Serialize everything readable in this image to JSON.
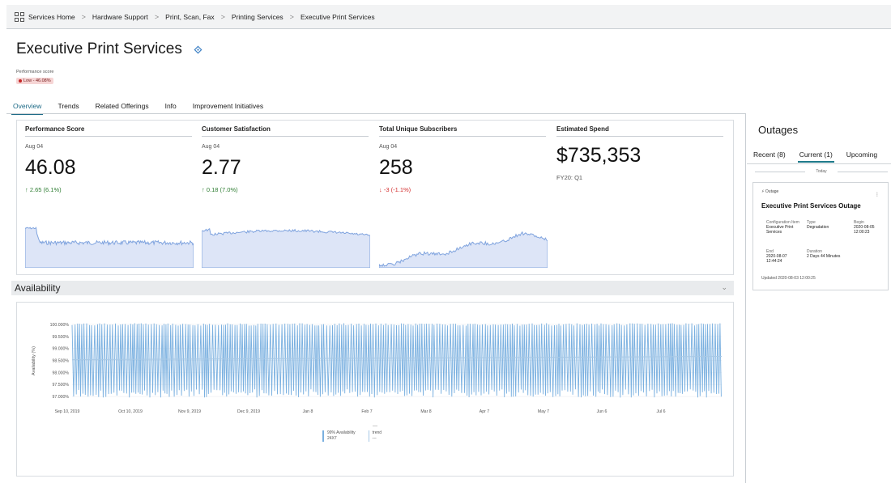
{
  "breadcrumb": [
    "Services Home",
    "Hardware Support",
    "Print, Scan, Fax",
    "Printing Services",
    "Executive Print Services"
  ],
  "page": {
    "title": "Executive Print Services",
    "performance_label": "Performance score",
    "performance_badge": "Low - 46.08%"
  },
  "tabs": [
    "Overview",
    "Trends",
    "Related Offerings",
    "Info",
    "Improvement Initiatives"
  ],
  "metrics": [
    {
      "label": "Performance Score",
      "date": "Aug 04",
      "value": "46.08",
      "delta": "↑ 2.65 (6.1%)",
      "trend": "up"
    },
    {
      "label": "Customer Satisfaction",
      "date": "Aug 04",
      "value": "2.77",
      "delta": "↑ 0.18 (7.0%)",
      "trend": "up"
    },
    {
      "label": "Total Unique Subscribers",
      "date": "Aug 04",
      "value": "258",
      "delta": "↓ -3 (-1.1%)",
      "trend": "down"
    },
    {
      "label": "Estimated Spend",
      "date": "",
      "value": "$735,353",
      "delta": "FY20: Q1",
      "trend": "neutral"
    }
  ],
  "availability": {
    "section_title": "Availability",
    "legend": [
      {
        "name": "99% Availability",
        "sub": "24X7"
      },
      {
        "name": "trend",
        "sub": "---"
      }
    ],
    "legend_dash": "—"
  },
  "chart_data": {
    "type": "line",
    "title": "",
    "ylabel": "Availability (%)",
    "ylim": [
      96.8,
      100.1
    ],
    "yticks": [
      "100.000%",
      "99.500%",
      "99.000%",
      "98.500%",
      "98.000%",
      "97.500%",
      "97.000%"
    ],
    "xticks": [
      "Sep 10, 2019",
      "Oct 10, 2019",
      "Nov 9, 2019",
      "Dec 9, 2019",
      "Jan 8",
      "Feb 7",
      "Mar 8",
      "Apr 7",
      "May 7",
      "Jun 6",
      "Jul 6"
    ],
    "series": [
      {
        "name": "99% Availability",
        "pattern": "oscillating between ~100.0% and ~97.0%",
        "color": "#7ab0e0"
      },
      {
        "name": "trend",
        "approx": 98.6,
        "color": "#a8c9e6"
      }
    ]
  },
  "outages": {
    "title": "Outages",
    "tabs": [
      "Recent (8)",
      "Current (1)",
      "Upcoming"
    ],
    "active_tab": 1,
    "day_label": "Today",
    "card": {
      "type_label": "Outage",
      "more": "⋮",
      "title": "Executive Print Services Outage",
      "fields": [
        {
          "label": "Configuration Item",
          "value": "Executive Print Services"
        },
        {
          "label": "Type",
          "value": "Degradation"
        },
        {
          "label": "Begin",
          "value": "2020-08-05 12:00:23"
        },
        {
          "label": "End",
          "value": "2020-08-07 12:44:24"
        },
        {
          "label": "Duration",
          "value": "2 Days 44 Minutes"
        }
      ],
      "updated": "Updated 2020-08-03 12:00:25"
    }
  },
  "colors": {
    "accent": "#1e6b87",
    "spark_fill": "#dde5f7",
    "spark_line": "#7fa3de",
    "chart_line": "#7ab0e0"
  }
}
